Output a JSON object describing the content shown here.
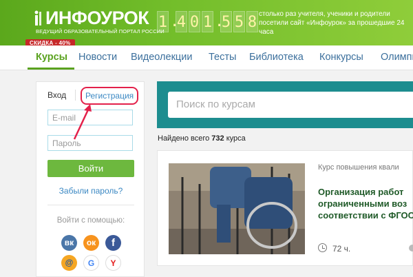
{
  "header": {
    "logo_text": "ИНФОУРОК",
    "logo_subtitle": "ВЕДУЩИЙ ОБРАЗОВАТЕЛЬНЫЙ ПОРТАЛ РОССИИ",
    "sale_badge": "СКИДКА - 40%",
    "counter_digits": [
      "1",
      ".",
      "4",
      "0",
      "1",
      ".",
      "5",
      "5",
      "8"
    ],
    "counter_text": "столько раз учителя, ученики и родители посетили сайт «Инфоурок» за прошедшие 24 часа"
  },
  "nav": {
    "items": [
      "Курсы",
      "Новости",
      "Видеолекции",
      "Тесты",
      "Библиотека",
      "Конкурсы",
      "Олимпи"
    ]
  },
  "login": {
    "tab_login": "Вход",
    "tab_register": "Регистрация",
    "email_placeholder": "E-mail",
    "password_placeholder": "Пароль",
    "submit_label": "Войти",
    "forgot_label": "Забыли пароль?",
    "social_label": "Войти с помощью:",
    "social": [
      {
        "name": "vk-icon",
        "glyph": "вк",
        "color": "#4a76a8"
      },
      {
        "name": "odnoklassniki-icon",
        "glyph": "ок",
        "color": "#f7931e"
      },
      {
        "name": "facebook-icon",
        "glyph": "f",
        "color": "#3b5998"
      },
      {
        "name": "mail-icon",
        "glyph": "@",
        "color": "#f5a623"
      },
      {
        "name": "google-icon",
        "glyph": "G",
        "color": "#ffffff"
      },
      {
        "name": "yandex-icon",
        "glyph": "Y",
        "color": "#ffffff"
      }
    ]
  },
  "search": {
    "placeholder": "Поиск по курсам"
  },
  "results": {
    "prefix": "Найдено всего",
    "count": "732",
    "suffix": "курса"
  },
  "course": {
    "type": "Курс повышения квали",
    "title_lines": [
      "Организация работ",
      "ограниченными воз",
      "соответствии с ФГОС"
    ],
    "hours": "72 ч."
  }
}
